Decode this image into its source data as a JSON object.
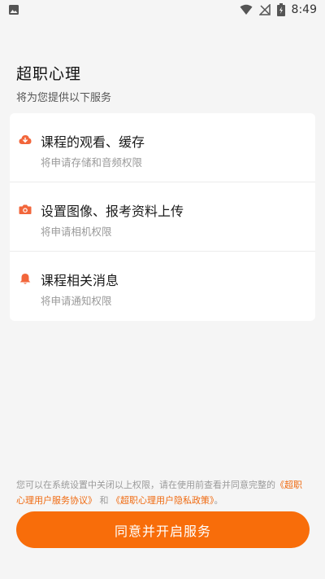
{
  "status_bar": {
    "time": "8:49",
    "icons": [
      "image-icon",
      "wifi-icon",
      "no-signal-icon",
      "battery-charging-icon"
    ]
  },
  "header": {
    "title": "超职心理",
    "subtitle": "将为您提供以下服务"
  },
  "permissions": [
    {
      "icon": "cloud-download-icon",
      "title": "课程的观看、缓存",
      "desc": "将申请存储和音频权限"
    },
    {
      "icon": "camera-icon",
      "title": "设置图像、报考资料上传",
      "desc": "将申请相机权限"
    },
    {
      "icon": "bell-icon",
      "title": "课程相关消息",
      "desc": "将申请通知权限"
    }
  ],
  "notice": {
    "text_before": "您可以在系统设置中关闭以上权限，请在使用前查看并同意完整的",
    "service_agreement": "《超职心理用户服务协议》",
    "and": "和",
    "privacy_policy": "《超职心理用户隐私政策》",
    "end": "。"
  },
  "agree_button": "同意并开启服务",
  "colors": {
    "accent": "#f86d0a",
    "icon": "#f2663b",
    "background": "#f5f5f5",
    "card": "#ffffff"
  }
}
